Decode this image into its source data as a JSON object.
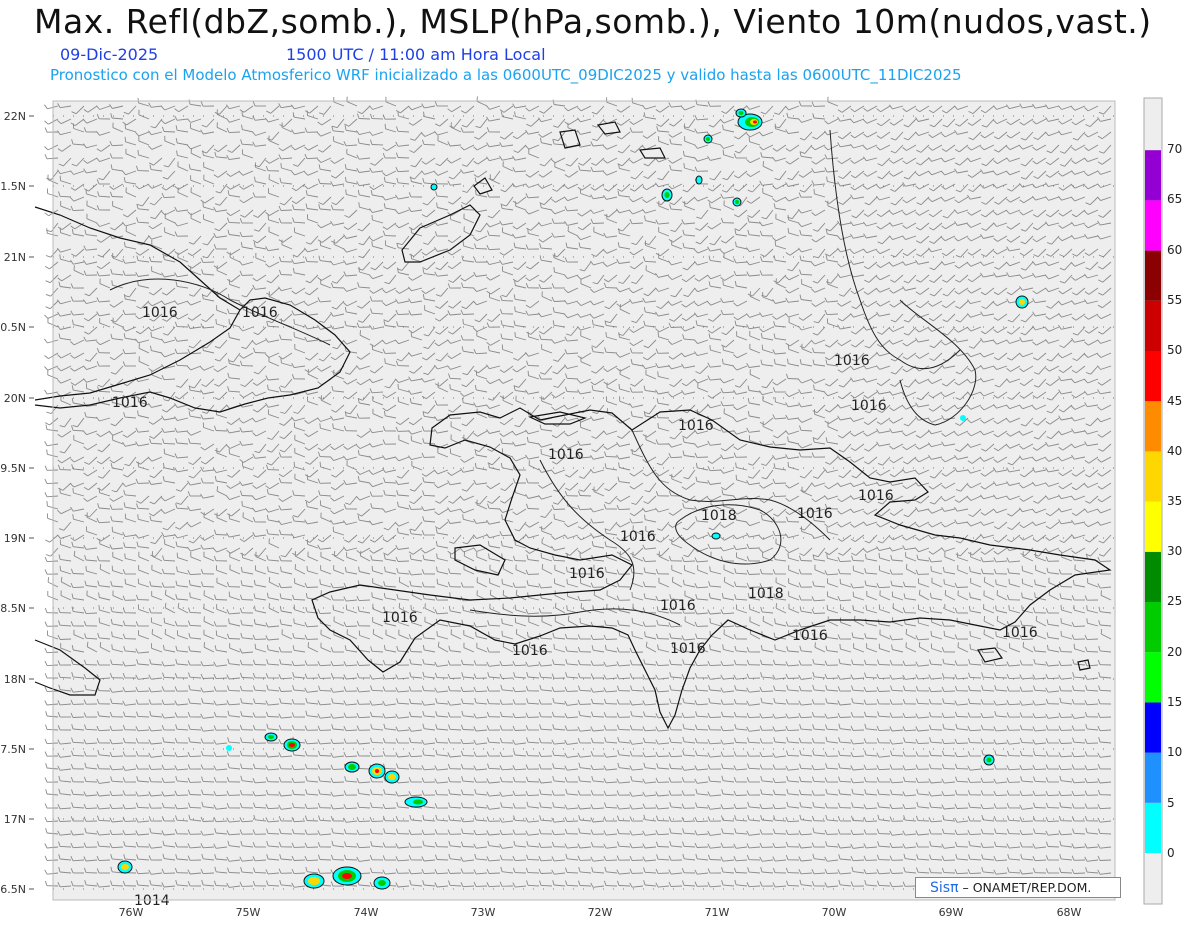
{
  "header": {
    "title": "Max. Refl(dbZ,somb.), MSLP(hPa,somb.), Viento 10m(nudos,vast.)",
    "date": "09-Dic-2025",
    "time": "1500 UTC / 11:00 am Hora Local",
    "description": "Pronostico con el Modelo Atmosferico WRF inicializado a las 0600UTC_09DIC2025 y valido hasta las  0600UTC_11DIC2025"
  },
  "map": {
    "lat_labels": [
      "22N",
      "1.5N",
      "21N",
      "0.5N",
      "20N",
      "9.5N",
      "19N",
      "8.5N",
      "18N",
      "7.5N",
      "17N",
      "6.5N"
    ],
    "lon_labels": [
      "76W",
      "75W",
      "74W",
      "73W",
      "72W",
      "71W",
      "70W",
      "69W",
      "68W"
    ],
    "isobar_labels": [
      {
        "text": "1016"
      },
      {
        "text": "1016"
      },
      {
        "text": "1016"
      },
      {
        "text": "1016"
      },
      {
        "text": "1016"
      },
      {
        "text": "1016"
      },
      {
        "text": "1016"
      },
      {
        "text": "1018"
      },
      {
        "text": "1016"
      },
      {
        "text": "1016"
      },
      {
        "text": "1016"
      },
      {
        "text": "1016"
      },
      {
        "text": "1018"
      },
      {
        "text": "1016"
      },
      {
        "text": "1016"
      },
      {
        "text": "1016"
      },
      {
        "text": "1016"
      },
      {
        "text": "1016"
      },
      {
        "text": "1016"
      },
      {
        "text": "1014"
      }
    ],
    "colors": {
      "background": "#eeeeee",
      "coast": "#111111",
      "isobar": "#222222",
      "barb": "#8a8a8a"
    }
  },
  "colorbar": {
    "levels": [
      "0",
      "5",
      "10",
      "15",
      "20",
      "25",
      "30",
      "35",
      "40",
      "45",
      "50",
      "55",
      "60",
      "65",
      "70"
    ],
    "colors": [
      "#00ffff",
      "#1e90ff",
      "#0000ff",
      "#00ff00",
      "#00cc00",
      "#008b00",
      "#ffff00",
      "#ffd700",
      "#ff8c00",
      "#ff0000",
      "#cc0000",
      "#8b0000",
      "#ff00ff",
      "#9400d3"
    ]
  },
  "credit": {
    "brand": "Sisπ",
    "text": "– ONAMET/REP.DOM."
  }
}
